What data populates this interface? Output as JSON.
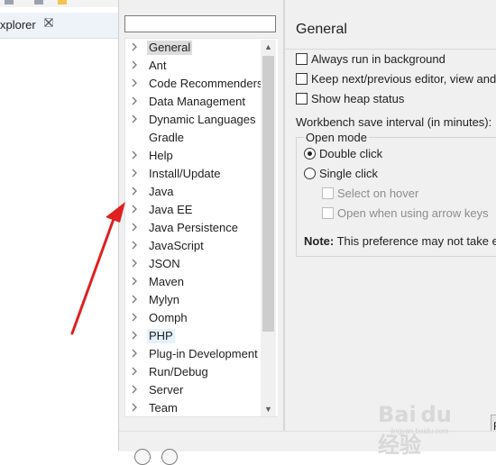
{
  "background_window": {
    "tab_label": "xplorer",
    "tab_close_icon": "close-icon"
  },
  "filter": {
    "value": "",
    "placeholder": ""
  },
  "tree": {
    "items": [
      {
        "label": "General",
        "expandable": true,
        "state": "selected"
      },
      {
        "label": "Ant",
        "expandable": true
      },
      {
        "label": "Code Recommenders",
        "expandable": true
      },
      {
        "label": "Data Management",
        "expandable": true
      },
      {
        "label": "Dynamic Languages",
        "expandable": true
      },
      {
        "label": "Gradle",
        "expandable": false
      },
      {
        "label": "Help",
        "expandable": true
      },
      {
        "label": "Install/Update",
        "expandable": true
      },
      {
        "label": "Java",
        "expandable": true
      },
      {
        "label": "Java EE",
        "expandable": true
      },
      {
        "label": "Java Persistence",
        "expandable": true
      },
      {
        "label": "JavaScript",
        "expandable": true
      },
      {
        "label": "JSON",
        "expandable": true
      },
      {
        "label": "Maven",
        "expandable": true
      },
      {
        "label": "Mylyn",
        "expandable": true
      },
      {
        "label": "Oomph",
        "expandable": true
      },
      {
        "label": "PHP",
        "expandable": true,
        "state": "hover"
      },
      {
        "label": "Plug-in Development",
        "expandable": true
      },
      {
        "label": "Run/Debug",
        "expandable": true
      },
      {
        "label": "Server",
        "expandable": true
      },
      {
        "label": "Team",
        "expandable": true
      }
    ],
    "scroll_up_icon": "chevron-up-icon",
    "scroll_down_icon": "chevron-down-icon"
  },
  "page": {
    "title": "General",
    "checkboxes": [
      {
        "label": "Always run in background",
        "checked": false
      },
      {
        "label": "Keep next/previous editor, view and",
        "checked": false
      },
      {
        "label": "Show heap status",
        "checked": false
      }
    ],
    "interval_label": "Workbench save interval (in minutes):",
    "open_mode": {
      "legend": "Open mode",
      "options": [
        {
          "label": "Double click",
          "checked": true
        },
        {
          "label": "Single click",
          "checked": false
        }
      ],
      "sub_options": [
        {
          "label": "Select on hover",
          "checked": false,
          "enabled": false
        },
        {
          "label": "Open when using arrow keys",
          "checked": false,
          "enabled": false
        }
      ],
      "note_bold": "Note:",
      "note_text": " This preference may not take e"
    },
    "side_button_label": "R"
  },
  "watermark": {
    "logo": "Bai du 经验",
    "sub": "jingyan.baidu.com"
  },
  "colors": {
    "annotation_arrow": "#e02020",
    "selection": "#dcdcdc",
    "hover": "#e5f1fb"
  }
}
